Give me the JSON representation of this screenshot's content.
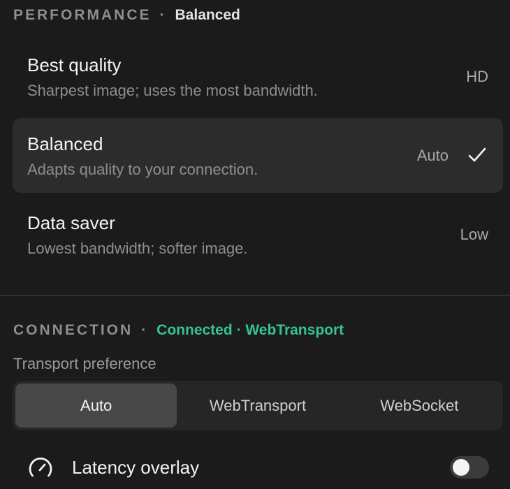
{
  "performance": {
    "title": "PERFORMANCE",
    "separator": "·",
    "current": "Balanced",
    "options": [
      {
        "title": "Best quality",
        "description": "Sharpest image; uses the most bandwidth.",
        "tag": "HD",
        "selected": false
      },
      {
        "title": "Balanced",
        "description": "Adapts quality to your connection.",
        "tag": "Auto",
        "selected": true,
        "icon": "check-icon"
      },
      {
        "title": "Data saver",
        "description": "Lowest bandwidth; softer image.",
        "tag": "Low",
        "selected": false
      }
    ]
  },
  "connection": {
    "title": "CONNECTION",
    "separator": "·",
    "status": "Connected · WebTransport",
    "status_color": "#35c48f",
    "transport_label": "Transport preference",
    "transport_options": [
      "Auto",
      "WebTransport",
      "WebSocket"
    ],
    "transport_selected": "Auto"
  },
  "latency_overlay": {
    "label": "Latency overlay",
    "icon": "gauge-icon",
    "enabled": false
  }
}
